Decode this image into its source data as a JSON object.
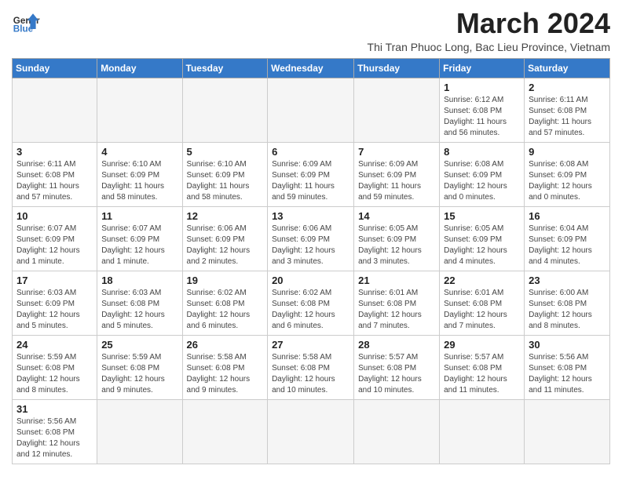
{
  "logo": {
    "text_general": "General",
    "text_blue": "Blue"
  },
  "title": "March 2024",
  "subtitle": "Thi Tran Phuoc Long, Bac Lieu Province, Vietnam",
  "days_of_week": [
    "Sunday",
    "Monday",
    "Tuesday",
    "Wednesday",
    "Thursday",
    "Friday",
    "Saturday"
  ],
  "weeks": [
    [
      {
        "day": "",
        "info": ""
      },
      {
        "day": "",
        "info": ""
      },
      {
        "day": "",
        "info": ""
      },
      {
        "day": "",
        "info": ""
      },
      {
        "day": "",
        "info": ""
      },
      {
        "day": "1",
        "info": "Sunrise: 6:12 AM\nSunset: 6:08 PM\nDaylight: 11 hours and 56 minutes."
      },
      {
        "day": "2",
        "info": "Sunrise: 6:11 AM\nSunset: 6:08 PM\nDaylight: 11 hours and 57 minutes."
      }
    ],
    [
      {
        "day": "3",
        "info": "Sunrise: 6:11 AM\nSunset: 6:08 PM\nDaylight: 11 hours and 57 minutes."
      },
      {
        "day": "4",
        "info": "Sunrise: 6:10 AM\nSunset: 6:09 PM\nDaylight: 11 hours and 58 minutes."
      },
      {
        "day": "5",
        "info": "Sunrise: 6:10 AM\nSunset: 6:09 PM\nDaylight: 11 hours and 58 minutes."
      },
      {
        "day": "6",
        "info": "Sunrise: 6:09 AM\nSunset: 6:09 PM\nDaylight: 11 hours and 59 minutes."
      },
      {
        "day": "7",
        "info": "Sunrise: 6:09 AM\nSunset: 6:09 PM\nDaylight: 11 hours and 59 minutes."
      },
      {
        "day": "8",
        "info": "Sunrise: 6:08 AM\nSunset: 6:09 PM\nDaylight: 12 hours and 0 minutes."
      },
      {
        "day": "9",
        "info": "Sunrise: 6:08 AM\nSunset: 6:09 PM\nDaylight: 12 hours and 0 minutes."
      }
    ],
    [
      {
        "day": "10",
        "info": "Sunrise: 6:07 AM\nSunset: 6:09 PM\nDaylight: 12 hours and 1 minute."
      },
      {
        "day": "11",
        "info": "Sunrise: 6:07 AM\nSunset: 6:09 PM\nDaylight: 12 hours and 1 minute."
      },
      {
        "day": "12",
        "info": "Sunrise: 6:06 AM\nSunset: 6:09 PM\nDaylight: 12 hours and 2 minutes."
      },
      {
        "day": "13",
        "info": "Sunrise: 6:06 AM\nSunset: 6:09 PM\nDaylight: 12 hours and 3 minutes."
      },
      {
        "day": "14",
        "info": "Sunrise: 6:05 AM\nSunset: 6:09 PM\nDaylight: 12 hours and 3 minutes."
      },
      {
        "day": "15",
        "info": "Sunrise: 6:05 AM\nSunset: 6:09 PM\nDaylight: 12 hours and 4 minutes."
      },
      {
        "day": "16",
        "info": "Sunrise: 6:04 AM\nSunset: 6:09 PM\nDaylight: 12 hours and 4 minutes."
      }
    ],
    [
      {
        "day": "17",
        "info": "Sunrise: 6:03 AM\nSunset: 6:09 PM\nDaylight: 12 hours and 5 minutes."
      },
      {
        "day": "18",
        "info": "Sunrise: 6:03 AM\nSunset: 6:08 PM\nDaylight: 12 hours and 5 minutes."
      },
      {
        "day": "19",
        "info": "Sunrise: 6:02 AM\nSunset: 6:08 PM\nDaylight: 12 hours and 6 minutes."
      },
      {
        "day": "20",
        "info": "Sunrise: 6:02 AM\nSunset: 6:08 PM\nDaylight: 12 hours and 6 minutes."
      },
      {
        "day": "21",
        "info": "Sunrise: 6:01 AM\nSunset: 6:08 PM\nDaylight: 12 hours and 7 minutes."
      },
      {
        "day": "22",
        "info": "Sunrise: 6:01 AM\nSunset: 6:08 PM\nDaylight: 12 hours and 7 minutes."
      },
      {
        "day": "23",
        "info": "Sunrise: 6:00 AM\nSunset: 6:08 PM\nDaylight: 12 hours and 8 minutes."
      }
    ],
    [
      {
        "day": "24",
        "info": "Sunrise: 5:59 AM\nSunset: 6:08 PM\nDaylight: 12 hours and 8 minutes."
      },
      {
        "day": "25",
        "info": "Sunrise: 5:59 AM\nSunset: 6:08 PM\nDaylight: 12 hours and 9 minutes."
      },
      {
        "day": "26",
        "info": "Sunrise: 5:58 AM\nSunset: 6:08 PM\nDaylight: 12 hours and 9 minutes."
      },
      {
        "day": "27",
        "info": "Sunrise: 5:58 AM\nSunset: 6:08 PM\nDaylight: 12 hours and 10 minutes."
      },
      {
        "day": "28",
        "info": "Sunrise: 5:57 AM\nSunset: 6:08 PM\nDaylight: 12 hours and 10 minutes."
      },
      {
        "day": "29",
        "info": "Sunrise: 5:57 AM\nSunset: 6:08 PM\nDaylight: 12 hours and 11 minutes."
      },
      {
        "day": "30",
        "info": "Sunrise: 5:56 AM\nSunset: 6:08 PM\nDaylight: 12 hours and 11 minutes."
      }
    ],
    [
      {
        "day": "31",
        "info": "Sunrise: 5:56 AM\nSunset: 6:08 PM\nDaylight: 12 hours and 12 minutes."
      },
      {
        "day": "",
        "info": ""
      },
      {
        "day": "",
        "info": ""
      },
      {
        "day": "",
        "info": ""
      },
      {
        "day": "",
        "info": ""
      },
      {
        "day": "",
        "info": ""
      },
      {
        "day": "",
        "info": ""
      }
    ]
  ]
}
